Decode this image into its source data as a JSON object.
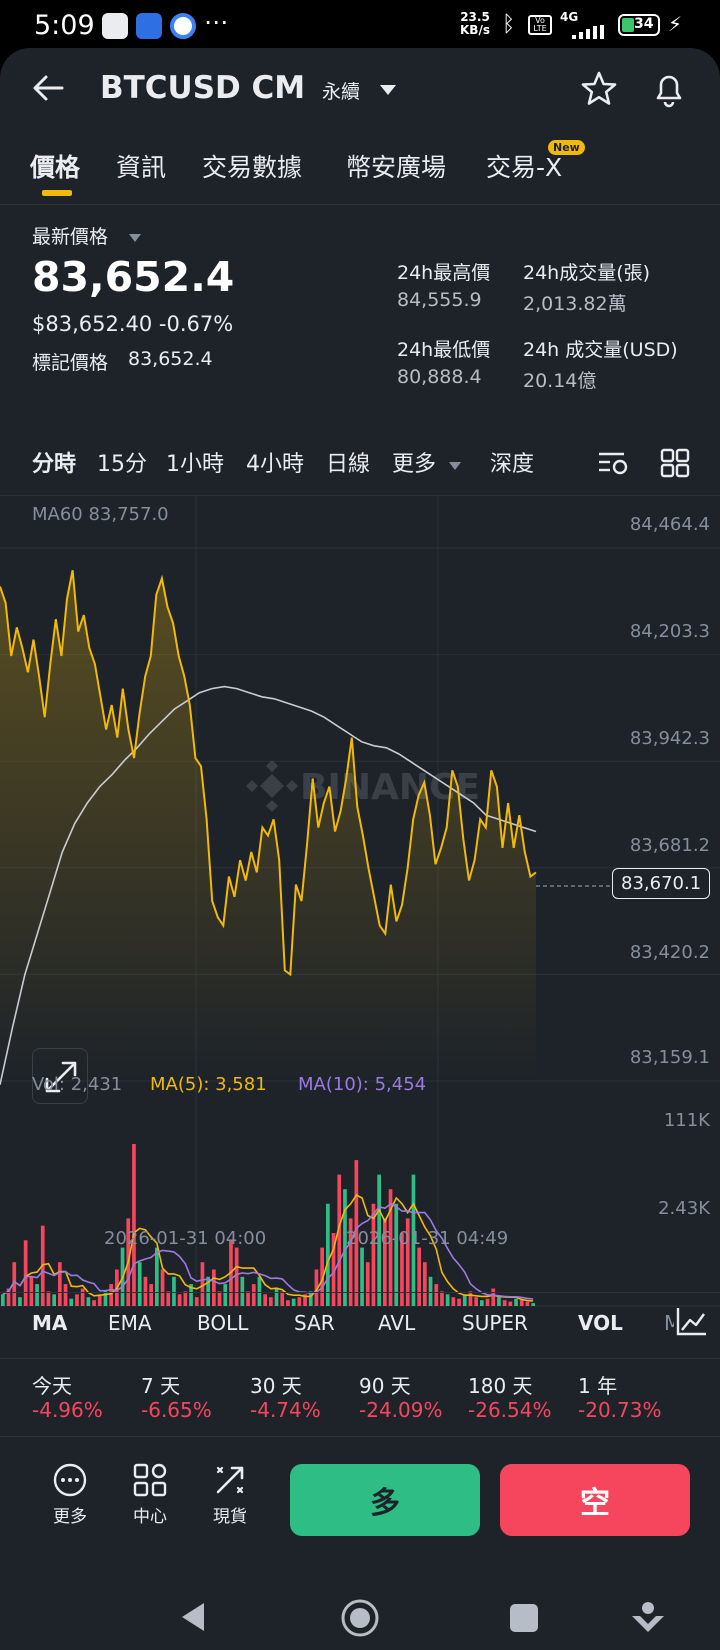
{
  "status_bar": {
    "time": "5:09",
    "net_speed": "23.5\nKB/s",
    "net_speed_top": "23.5",
    "net_speed_bottom": "KB/s",
    "signal": "4G",
    "battery": "34"
  },
  "header": {
    "symbol": "BTCUSD CM",
    "contract_type": "永續"
  },
  "tabs": [
    {
      "label": "價格",
      "active": true
    },
    {
      "label": "資訊"
    },
    {
      "label": "交易數據"
    },
    {
      "label": "幣安廣場"
    },
    {
      "label": "交易-X",
      "badge": "New"
    }
  ],
  "price": {
    "latest_label": "最新價格",
    "last": "83,652.4",
    "usd_and_change": "$83,652.40 -0.67%",
    "mark_label": "標記價格",
    "mark_value": "83,652.4"
  },
  "stats": {
    "high_label": "24h最高價",
    "high_value": "84,555.9",
    "vol_label": "24h成交量(張)",
    "vol_value": "2,013.82萬",
    "low_label": "24h最低價",
    "low_value": "80,888.4",
    "vol_usd_label": "24h 成交量(USD)",
    "vol_usd_value": "20.14億"
  },
  "timeframes": [
    "分時",
    "15分",
    "1小時",
    "4小時",
    "日線",
    "更多",
    "深度"
  ],
  "chart": {
    "ma60_label": "MA60 83,757.0",
    "watermark": "BINANCE",
    "y_ticks": [
      "84,464.4",
      "84,203.3",
      "83,942.3",
      "83,681.2",
      "83,420.2",
      "83,159.1"
    ],
    "current_price_tag": "83,670.1",
    "vol_label": "Vol: 2,431",
    "ma5_label": "MA(5): 3,581",
    "ma10_label": "MA(10): 5,454",
    "vol_ticks": [
      "111K",
      "2.43K"
    ],
    "x_ticks": [
      "2026-01-31 04:00",
      "2026-01-31 04:49"
    ]
  },
  "indicators": [
    "MA",
    "EMA",
    "BOLL",
    "SAR",
    "AVL",
    "SUPER",
    "VOL",
    "M"
  ],
  "performance": [
    {
      "label": "今天",
      "value": "-4.96%"
    },
    {
      "label": "7 天",
      "value": "-6.65%"
    },
    {
      "label": "30 天",
      "value": "-4.74%"
    },
    {
      "label": "90 天",
      "value": "-24.09%"
    },
    {
      "label": "180 天",
      "value": "-26.54%"
    },
    {
      "label": "1 年",
      "value": "-20.73%"
    }
  ],
  "bottom_bar": {
    "more": "更多",
    "center": "中心",
    "spot": "現貨",
    "long": "多",
    "short": "空"
  },
  "chart_data": {
    "type": "line",
    "y_range": [
      83159.1,
      84464.4
    ],
    "price": [
      84370,
      84330,
      84200,
      84270,
      84220,
      84160,
      84240,
      84150,
      84050,
      84180,
      84290,
      84200,
      84340,
      84410,
      84260,
      84300,
      84220,
      84180,
      84100,
      84020,
      84080,
      84000,
      84120,
      84020,
      83950,
      84060,
      84150,
      84200,
      84350,
      84390,
      84320,
      84280,
      84200,
      84150,
      84080,
      83950,
      83930,
      83800,
      83600,
      83560,
      83540,
      83660,
      83610,
      83700,
      83650,
      83720,
      83670,
      83780,
      83760,
      83800,
      83700,
      83430,
      83420,
      83640,
      83600,
      83740,
      83900,
      83780,
      83840,
      83880,
      83770,
      83820,
      83900,
      84000,
      83830,
      83760,
      83680,
      83610,
      83540,
      83520,
      83640,
      83550,
      83590,
      83680,
      83800,
      83860,
      83890,
      83810,
      83690,
      83730,
      83780,
      83920,
      83880,
      83750,
      83650,
      83700,
      83800,
      83780,
      83920,
      83880,
      83730,
      83840,
      83730,
      83810,
      83720,
      83660,
      83670
    ],
    "ma60": [
      83150,
      83290,
      83420,
      83520,
      83620,
      83720,
      83790,
      83840,
      83880,
      83910,
      83945,
      83975,
      84010,
      84040,
      84070,
      84090,
      84110,
      84120,
      84125,
      84120,
      84110,
      84100,
      84095,
      84085,
      84075,
      84065,
      84050,
      84030,
      84010,
      83990,
      83980,
      83975,
      83960,
      83940,
      83920,
      83900,
      83880,
      83860,
      83840,
      83810,
      83800,
      83790,
      83780,
      83770
    ],
    "volume_series": [
      {
        "name": "Vol",
        "values": [
          8,
          12,
          30,
          6,
          45,
          20,
          15,
          55,
          10,
          8,
          30,
          15,
          5,
          8,
          12,
          6,
          4,
          7,
          10,
          15,
          25,
          40,
          60,
          111,
          30,
          20,
          15,
          40,
          25,
          10,
          20,
          8,
          10,
          15,
          6,
          30,
          20,
          25,
          10,
          15,
          45,
          40,
          20,
          10,
          15,
          20,
          8,
          6,
          12,
          10,
          4,
          5,
          6,
          8,
          10,
          25,
          40,
          70,
          50,
          90,
          80,
          60,
          100,
          40,
          30,
          70,
          90,
          60,
          80,
          70,
          50,
          60,
          90,
          40,
          30,
          20,
          15,
          10,
          8,
          6,
          5,
          8,
          10,
          6,
          4,
          5,
          12,
          6,
          4,
          3,
          5,
          4,
          3,
          2
        ]
      }
    ]
  }
}
